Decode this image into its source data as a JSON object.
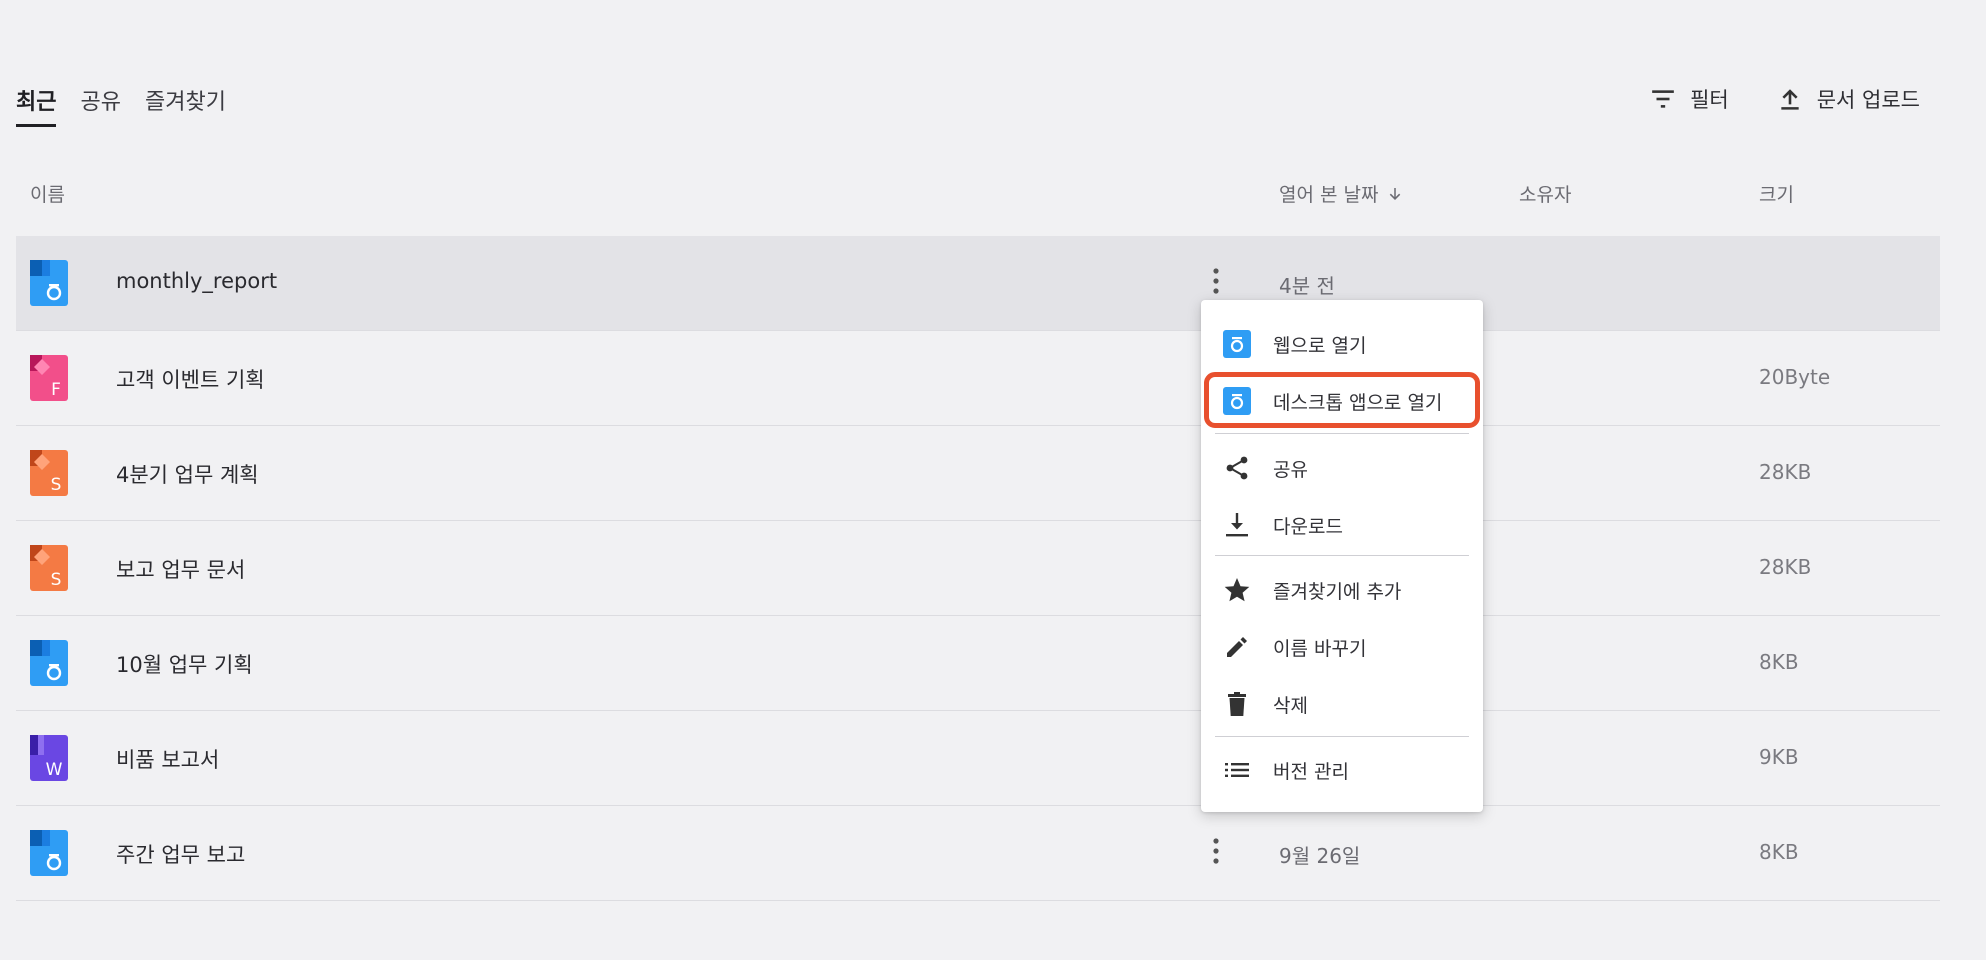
{
  "tabs": {
    "recent": "최근",
    "shared": "공유",
    "favorites": "즐겨찾기"
  },
  "toolbar": {
    "filter_label": "필터",
    "upload_label": "문서 업로드"
  },
  "table": {
    "headers": {
      "name": "이름",
      "opened": "열어 본 날짜",
      "owner": "소유자",
      "size": "크기"
    },
    "rows": [
      {
        "name": "monthly_report",
        "icon": "hangul-doc-icon",
        "opened": "4분 전",
        "owner": "",
        "size": ""
      },
      {
        "name": "고객 이벤트 기획",
        "icon": "form-doc-icon",
        "opened": "",
        "owner": "",
        "size": "20Byte"
      },
      {
        "name": "4분기 업무 계획",
        "icon": "sheet-doc-icon",
        "opened": "",
        "owner": "",
        "size": "28KB"
      },
      {
        "name": "보고 업무 문서",
        "icon": "sheet-doc-icon",
        "opened": "",
        "owner": "",
        "size": "28KB"
      },
      {
        "name": "10월 업무 기획",
        "icon": "hangul-doc-icon",
        "opened": "",
        "owner": "",
        "size": "8KB"
      },
      {
        "name": "비품 보고서",
        "icon": "word-doc-icon",
        "opened": "",
        "owner": "",
        "size": "9KB"
      },
      {
        "name": "주간 업무 보고",
        "icon": "hangul-doc-icon",
        "opened": "9월 26일",
        "owner": "",
        "size": "8KB"
      }
    ]
  },
  "context_menu": {
    "open_web": "웹으로 열기",
    "open_desktop": "데스크톱 앱으로 열기",
    "share": "공유",
    "download": "다운로드",
    "add_favorite": "즐겨찾기에 추가",
    "rename": "이름 바꾸기",
    "delete": "삭제",
    "version_manage": "버전 관리"
  },
  "colors": {
    "highlight": "#e8502e",
    "hangul_blue": "#2f9df4",
    "form_pink": "#f24f8a",
    "sheet_orange": "#f47a44",
    "word_purple": "#6a47e3"
  }
}
